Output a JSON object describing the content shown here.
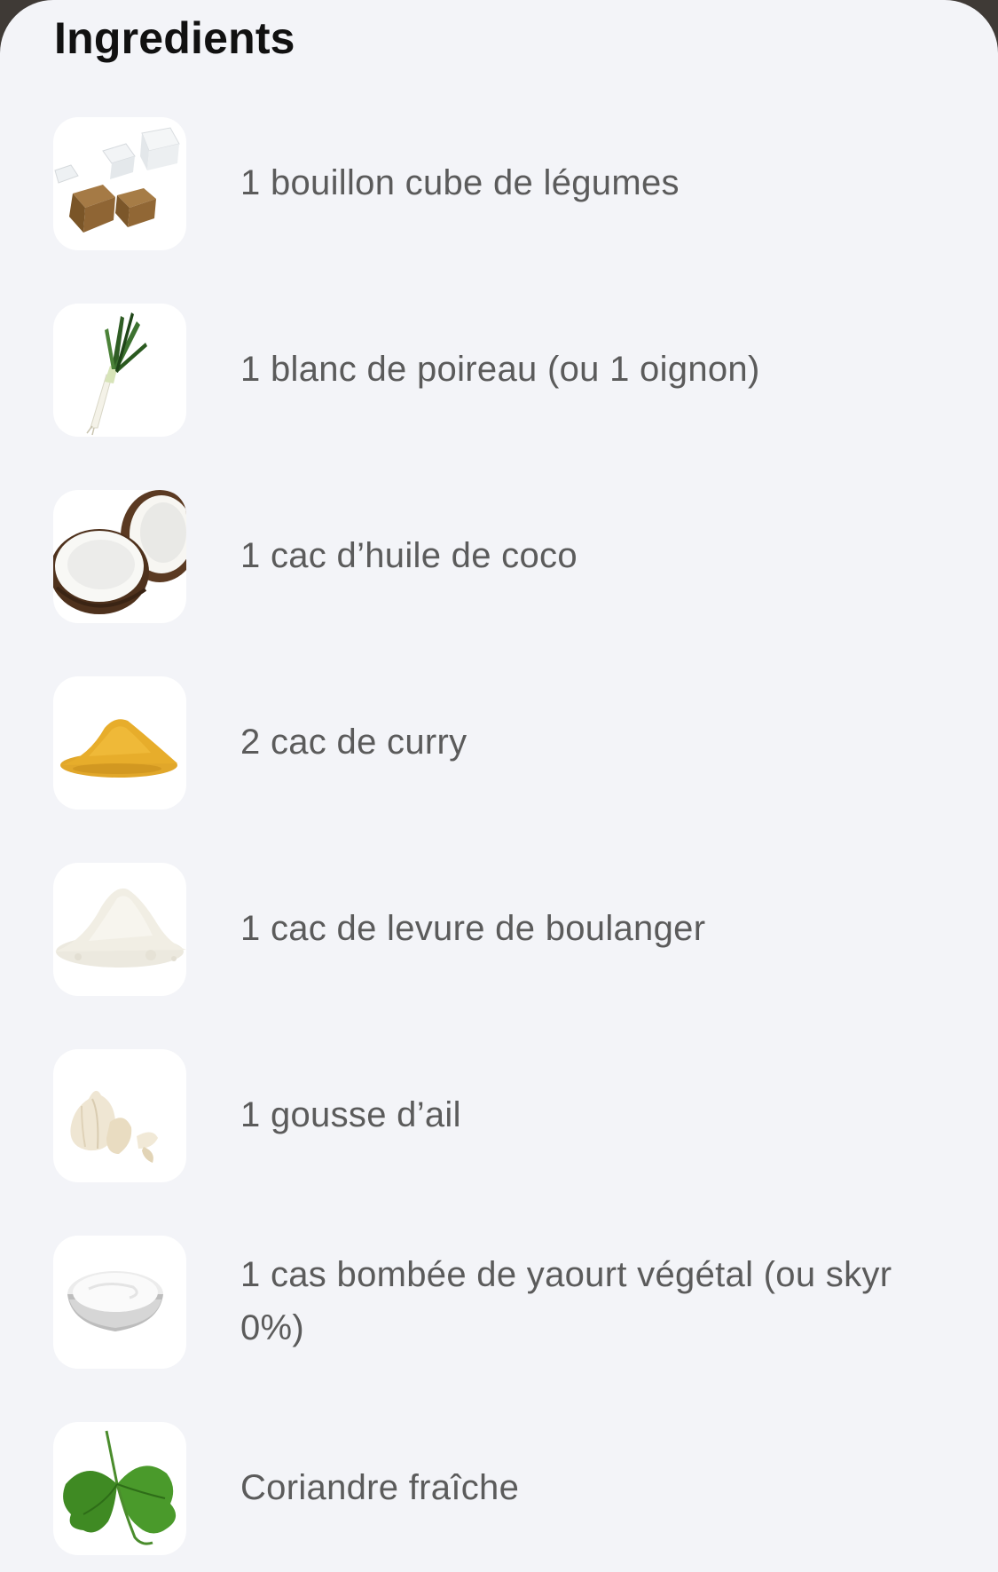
{
  "section": {
    "title": "Ingredients"
  },
  "ingredients": [
    {
      "label": "1 bouillon cube de légumes",
      "icon": "bouillon-cube-icon"
    },
    {
      "label": "1 blanc de poireau (ou 1 oignon)",
      "icon": "leek-icon"
    },
    {
      "label": "1 cac d’huile de coco",
      "icon": "coconut-icon"
    },
    {
      "label": "2 cac de curry",
      "icon": "curry-powder-icon"
    },
    {
      "label": "1 cac de levure de boulanger",
      "icon": "yeast-powder-icon"
    },
    {
      "label": "1 gousse d’ail",
      "icon": "garlic-icon"
    },
    {
      "label": "1 cas bombée de yaourt végétal (ou skyr 0%)",
      "icon": "yogurt-icon"
    },
    {
      "label": "Coriandre fraîche",
      "icon": "coriander-icon"
    }
  ]
}
